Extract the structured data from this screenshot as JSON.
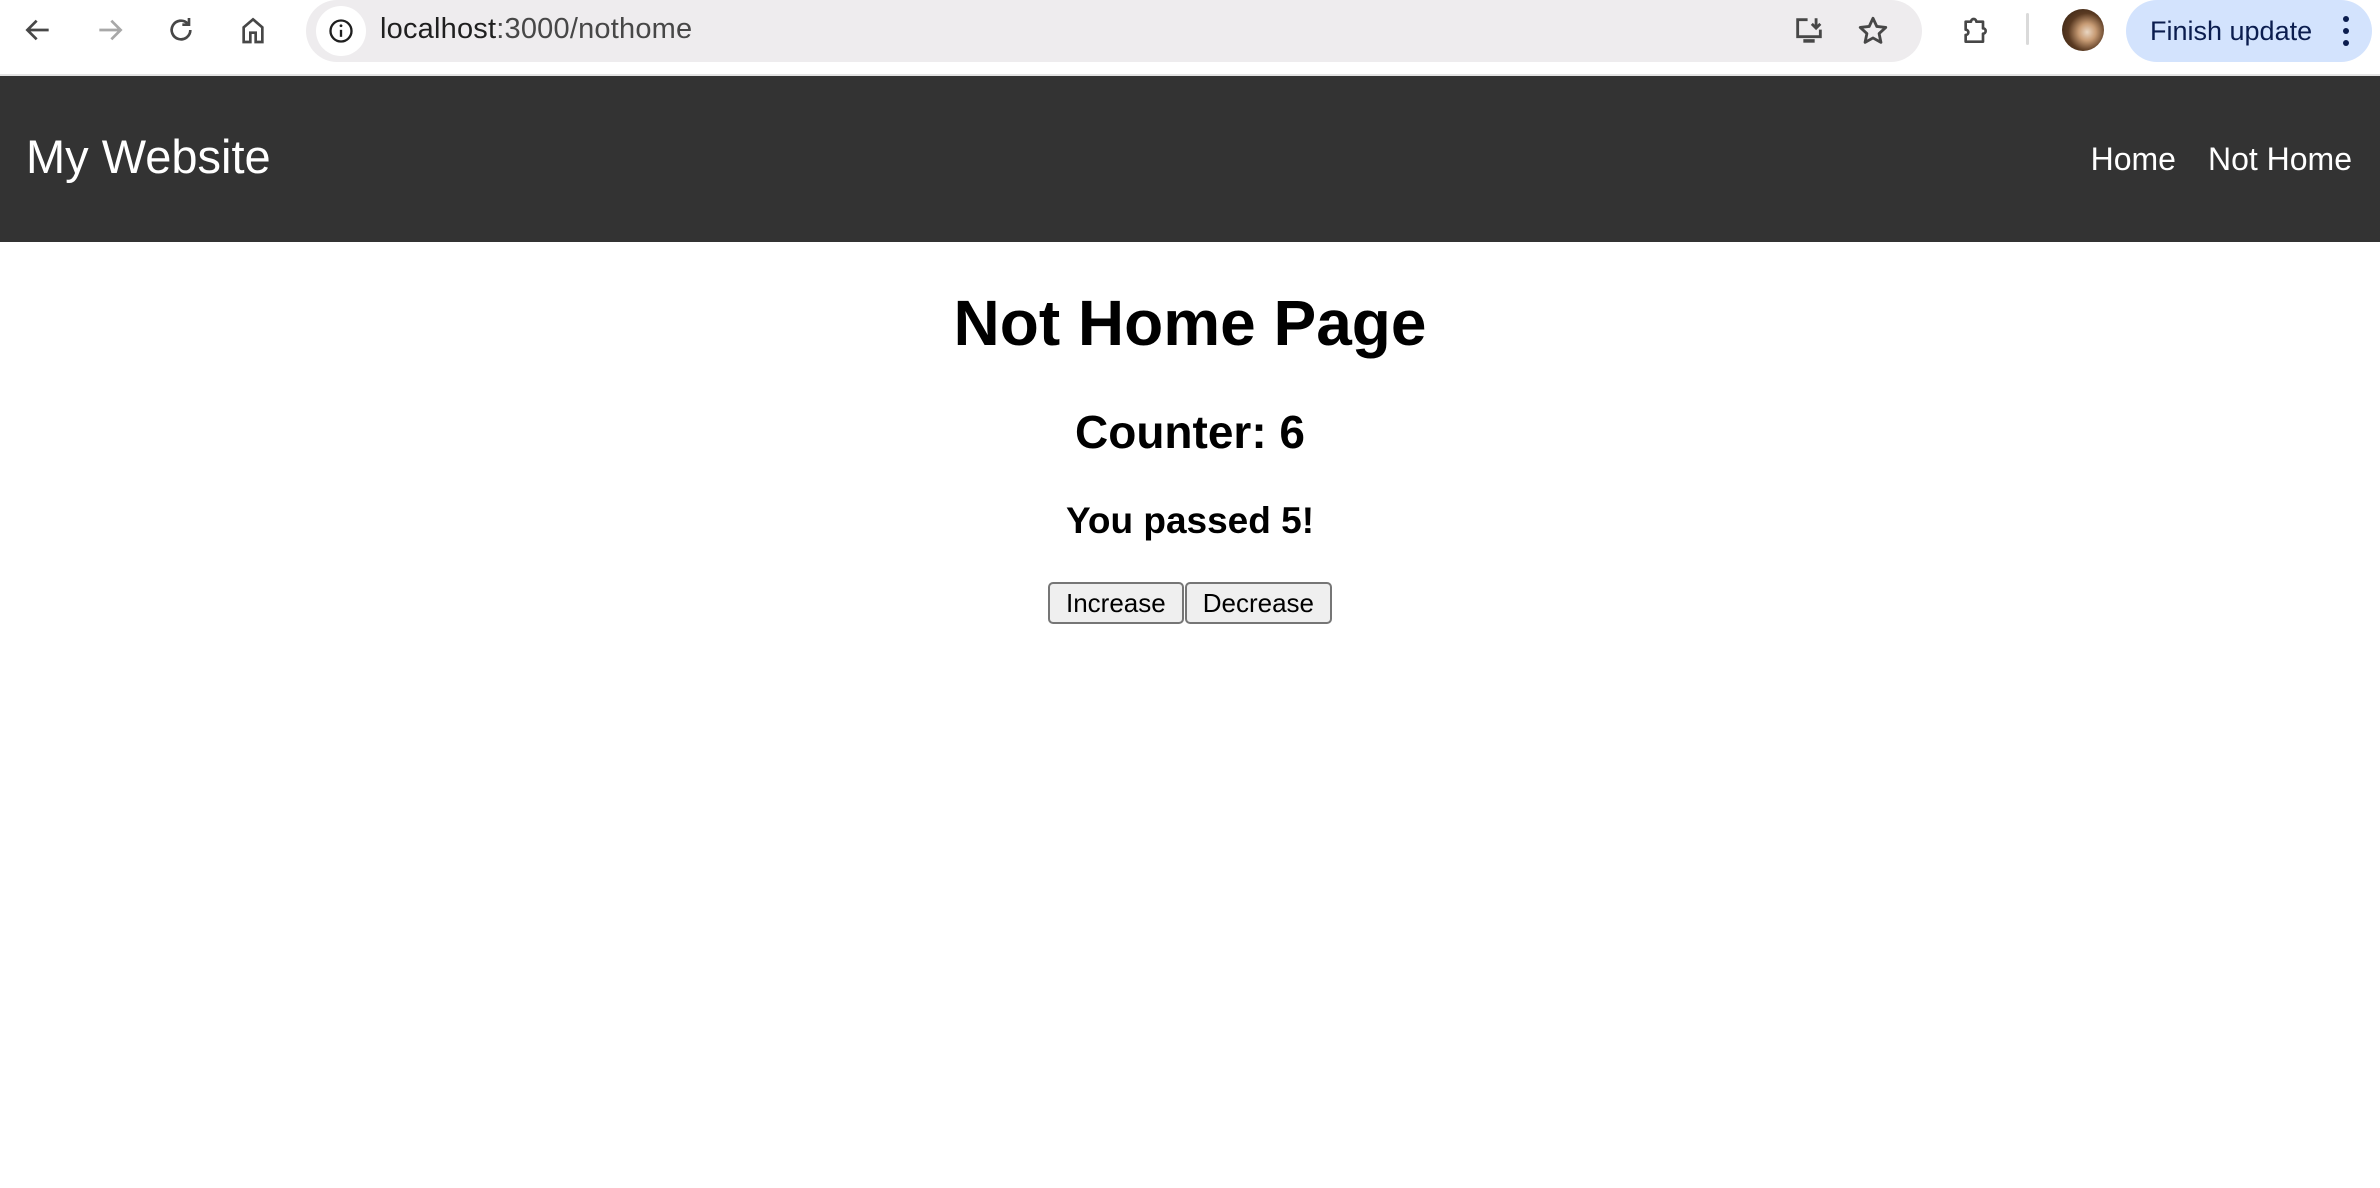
{
  "browser": {
    "url_host": "localhost",
    "url_path": ":3000/nothome",
    "icons": {
      "back": "arrow-left-icon",
      "forward": "arrow-right-icon",
      "reload": "reload-icon",
      "home": "home-icon",
      "site_info": "info-icon",
      "install": "install-app-icon",
      "bookmark": "star-icon",
      "extensions": "puzzle-icon",
      "profile": "avatar",
      "menu": "kebab-menu-icon"
    },
    "update_button_label": "Finish update"
  },
  "site": {
    "logo": "My Website",
    "nav": [
      {
        "label": "Home"
      },
      {
        "label": "Not Home"
      }
    ],
    "header_color": "#333333"
  },
  "main": {
    "title": "Not Home Page",
    "counter_text": "Counter: 6",
    "message": "You passed 5!",
    "buttons": {
      "increase": "Increase",
      "decrease": "Decrease"
    }
  }
}
